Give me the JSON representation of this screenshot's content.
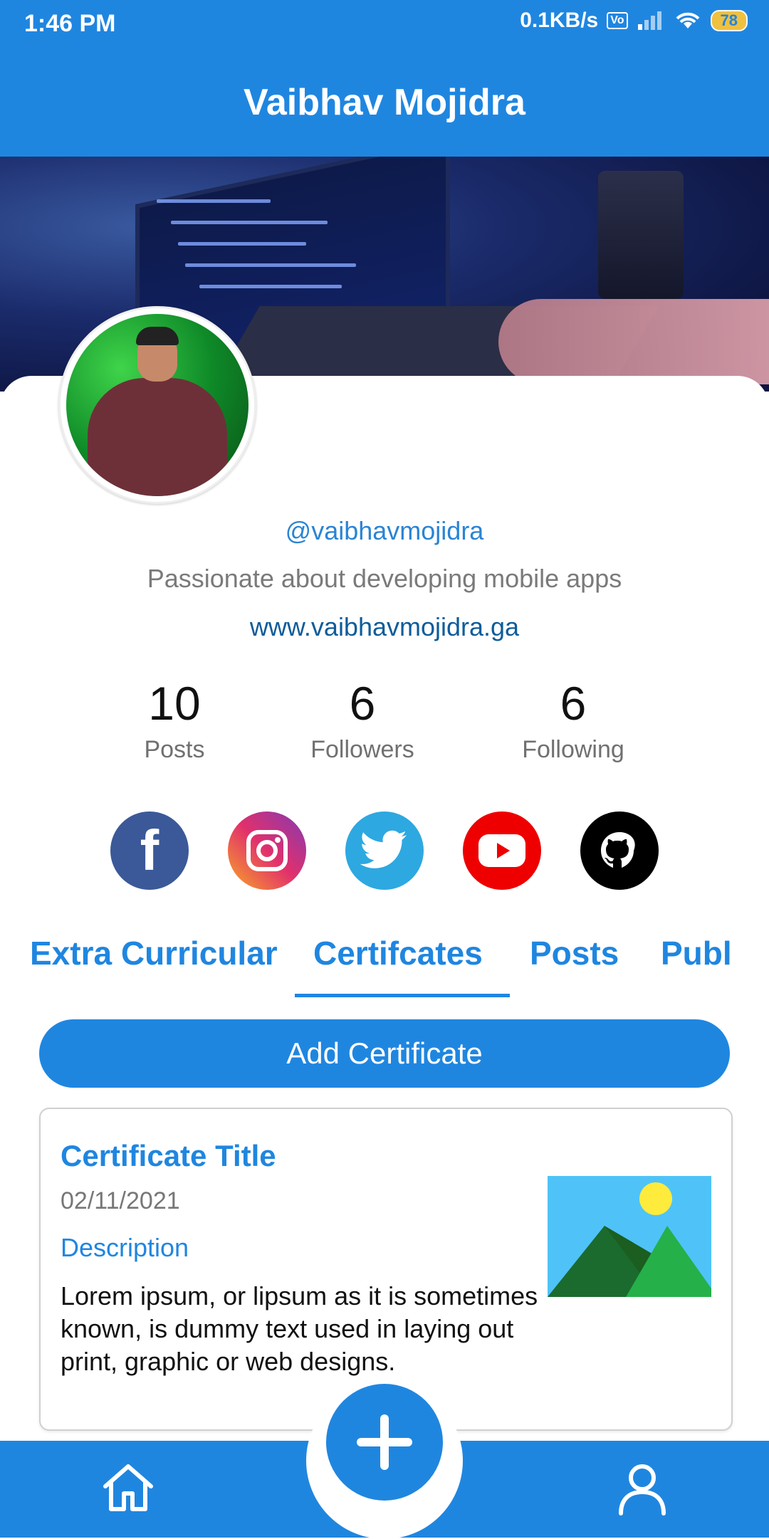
{
  "status_bar": {
    "time": "1:46 PM",
    "net_speed": "0.1KB/s",
    "battery": "78"
  },
  "app_bar": {
    "title": "Vaibhav Mojidra"
  },
  "profile": {
    "handle": "@vaibhavmojidra",
    "bio": "Passionate about developing mobile apps",
    "website": "www.vaibhavmojidra.ga",
    "stats": [
      {
        "value": "10",
        "label": "Posts"
      },
      {
        "value": "6",
        "label": "Followers"
      },
      {
        "value": "6",
        "label": "Following"
      }
    ]
  },
  "social_icons": [
    "facebook-icon",
    "instagram-icon",
    "twitter-icon",
    "youtube-icon",
    "github-icon"
  ],
  "tabs": [
    "Extra Curricular",
    "Certifcates",
    "Posts",
    "Publ"
  ],
  "active_tab": "Certifcates",
  "add_button": {
    "label": "Add Certificate"
  },
  "certificate": {
    "title": "Certificate Title",
    "date": "02/11/2021",
    "description_label": "Description",
    "description": "Lorem ipsum, or lipsum as it is sometimes known, is dummy text used in laying out print, graphic or web designs."
  },
  "colors": {
    "primary": "#1f86e0",
    "link": "#0e5c9a",
    "muted": "#7a7a7a"
  }
}
